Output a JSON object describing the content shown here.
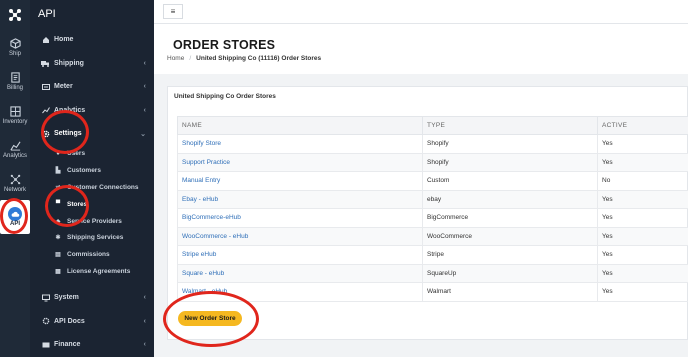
{
  "rail": {
    "items": [
      {
        "label": "Ship",
        "icon": "ship-icon"
      },
      {
        "label": "Billing",
        "icon": "billing-icon"
      },
      {
        "label": "Inventory",
        "icon": "inventory-icon"
      },
      {
        "label": "Analytics",
        "icon": "analytics-icon"
      },
      {
        "label": "Network",
        "icon": "network-icon"
      },
      {
        "label": "API",
        "icon": "api-cloud-icon"
      }
    ]
  },
  "sidebar": {
    "title": "API",
    "items": [
      {
        "label": "Home",
        "icon": "home-icon",
        "chevron": ""
      },
      {
        "label": "Shipping",
        "icon": "truck-icon",
        "chevron": "‹"
      },
      {
        "label": "Meter",
        "icon": "meter-icon",
        "chevron": "‹"
      },
      {
        "label": "Analytics",
        "icon": "chart-icon",
        "chevron": "‹"
      },
      {
        "label": "Settings",
        "icon": "gear-icon",
        "chevron": "⌄"
      }
    ],
    "sub_items": [
      {
        "label": "Users",
        "icon": "user-icon"
      },
      {
        "label": "Customers",
        "icon": "customers-icon"
      },
      {
        "label": "Customer Connections",
        "icon": "connections-icon"
      },
      {
        "label": "Stores",
        "icon": "store-icon"
      },
      {
        "label": "Service Providers",
        "icon": "provider-icon"
      },
      {
        "label": "Shipping Services",
        "icon": "services-icon"
      },
      {
        "label": "Commissions",
        "icon": "commissions-icon"
      },
      {
        "label": "License Agreements",
        "icon": "license-icon"
      }
    ],
    "bottom_items": [
      {
        "label": "System",
        "icon": "system-icon",
        "chevron": "‹"
      },
      {
        "label": "API Docs",
        "icon": "docs-icon",
        "chevron": "‹"
      },
      {
        "label": "Finance",
        "icon": "finance-icon",
        "chevron": "‹"
      }
    ]
  },
  "topbar": {
    "menu_glyph": "≡"
  },
  "header": {
    "title": "ORDER STORES",
    "breadcrumb_home": "Home",
    "breadcrumb_sep": "/",
    "breadcrumb_current": "United Shipping Co (11116) Order Stores"
  },
  "card": {
    "title": "United Shipping Co Order Stores",
    "columns": [
      "NAME",
      "TYPE",
      "ACTIVE"
    ],
    "rows": [
      [
        "Shopify Store",
        "Shopify",
        "Yes"
      ],
      [
        "Support Practice",
        "Shopify",
        "Yes"
      ],
      [
        "Manual Entry",
        "Custom",
        "No"
      ],
      [
        "Ebay - eHub",
        "ebay",
        "Yes"
      ],
      [
        "BigCommerce-eHub",
        "BigCommerce",
        "Yes"
      ],
      [
        "WooCommerce - eHub",
        "WooCommerce",
        "Yes"
      ],
      [
        "Stripe eHub",
        "Stripe",
        "Yes"
      ],
      [
        "Square - eHub",
        "SquareUp",
        "Yes"
      ],
      [
        "Walmart - eHub",
        "Walmart",
        "Yes"
      ]
    ],
    "new_button": "New Order Store"
  },
  "colors": {
    "accent": "#f5b820",
    "highlight_ring": "#e0261c",
    "link": "#2f6fb8",
    "sidebar_bg": "#1b2432"
  }
}
